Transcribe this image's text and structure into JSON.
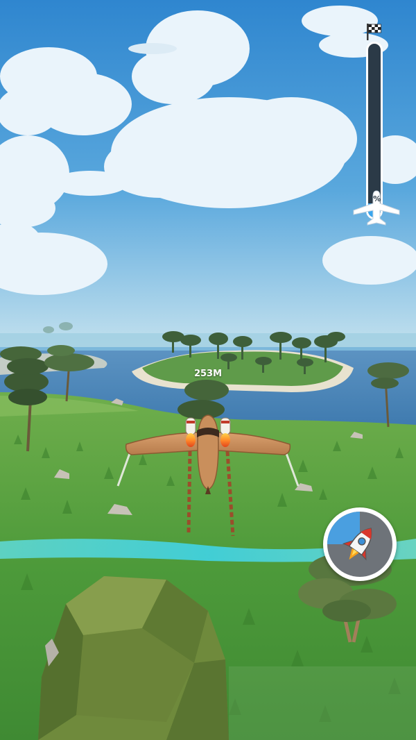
{
  "hud": {
    "distance_label": "253M",
    "progress_label": "8%",
    "progress_fraction": 0.08,
    "boost_cooldown_fraction": 0.25
  },
  "icons": {
    "finish": "checkered-flag-icon",
    "progress_marker": "airplane-icon",
    "boost": "rocket-icon"
  },
  "colors": {
    "sky_top": "#2f86cf",
    "sky_horizon": "#bfe0ee",
    "water": "#3f7fb5",
    "grass": "#4e9a3c",
    "plane_body": "#c78f60",
    "progress_track": "#2b3a47",
    "progress_fill": "#3aa6ef",
    "boost_bg": "#6e7379",
    "boost_charge": "#4a9fe0"
  }
}
